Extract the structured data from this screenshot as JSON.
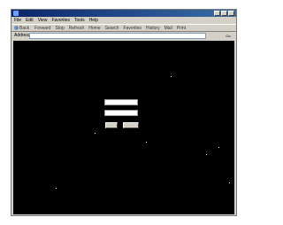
{
  "window": {
    "title": ""
  },
  "menubar": {
    "items": [
      "File",
      "Edit",
      "View",
      "Favorites",
      "Tools",
      "Help"
    ]
  },
  "toolbar": {
    "items": [
      "Back",
      "Forward",
      "Stop",
      "Refresh",
      "Home",
      "Search",
      "Favorites",
      "History",
      "Mail",
      "Print"
    ]
  },
  "addressbar": {
    "label": "Address",
    "value": "",
    "go_label": "Go"
  },
  "login": {
    "heading": "",
    "username_label": "",
    "username_value": "",
    "password_label": "",
    "password_value": "",
    "ok_label": "",
    "cancel_label": ""
  }
}
